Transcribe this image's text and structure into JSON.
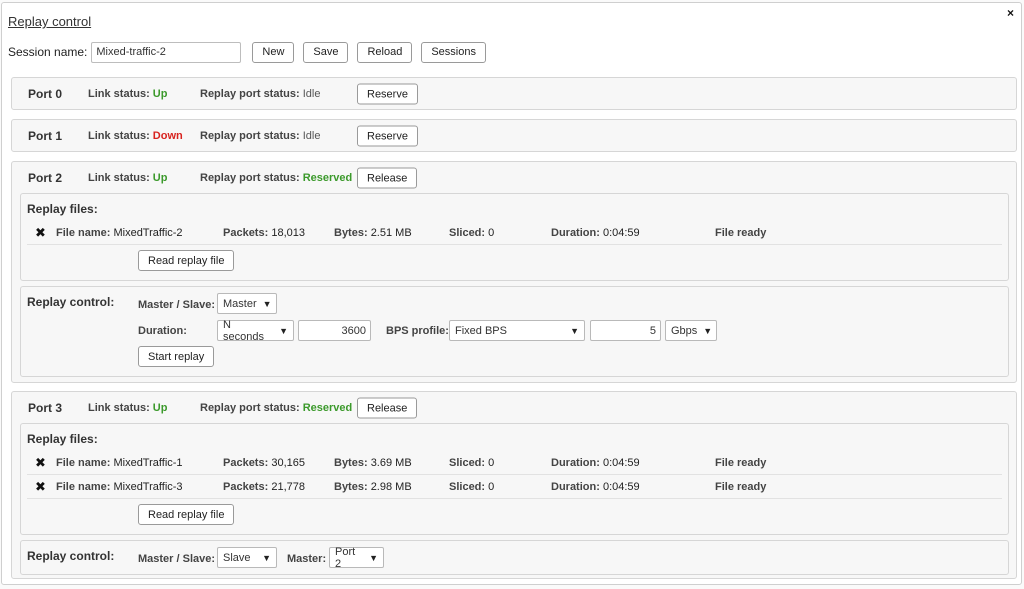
{
  "title": "Replay control",
  "close_glyph": "×",
  "session": {
    "label": "Session name:",
    "value": "Mixed-traffic-2",
    "buttons": {
      "new": "New",
      "save": "Save",
      "reload": "Reload",
      "sessions": "Sessions"
    }
  },
  "labels": {
    "link_status": "Link status:",
    "replay_port_status": "Replay port status:",
    "replay_files": "Replay files:",
    "replay_control": "Replay control:",
    "file_name": "File name:",
    "packets": "Packets:",
    "bytes": "Bytes:",
    "sliced": "Sliced:",
    "duration": "Duration:",
    "master_slave": "Master / Slave:",
    "duration_ctl": "Duration:",
    "bps_profile": "BPS profile:",
    "master": "Master:",
    "read_replay_file": "Read replay file",
    "start_replay": "Start replay"
  },
  "ports": [
    {
      "name": "Port 0",
      "link": "Up",
      "status": "Idle",
      "action": "Reserve"
    },
    {
      "name": "Port 1",
      "link": "Down",
      "status": "Idle",
      "action": "Reserve"
    },
    {
      "name": "Port 2",
      "link": "Up",
      "status": "Reserved",
      "action": "Release",
      "files": [
        {
          "name": "MixedTraffic-2",
          "packets": "18,013",
          "bytes": "2.51 MB",
          "sliced": "0",
          "duration": "0:04:59",
          "state": "File ready"
        }
      ],
      "control": {
        "mode": "Master",
        "duration_type": "N seconds",
        "duration_value": "3600",
        "bps_profile": "Fixed BPS",
        "bps_value": "5",
        "bps_unit": "Gbps"
      }
    },
    {
      "name": "Port 3",
      "link": "Up",
      "status": "Reserved",
      "action": "Release",
      "files": [
        {
          "name": "MixedTraffic-1",
          "packets": "30,165",
          "bytes": "3.69 MB",
          "sliced": "0",
          "duration": "0:04:59",
          "state": "File ready"
        },
        {
          "name": "MixedTraffic-3",
          "packets": "21,778",
          "bytes": "2.98 MB",
          "sliced": "0",
          "duration": "0:04:59",
          "state": "File ready"
        }
      ],
      "control": {
        "mode": "Slave",
        "master": "Port 2"
      }
    }
  ]
}
